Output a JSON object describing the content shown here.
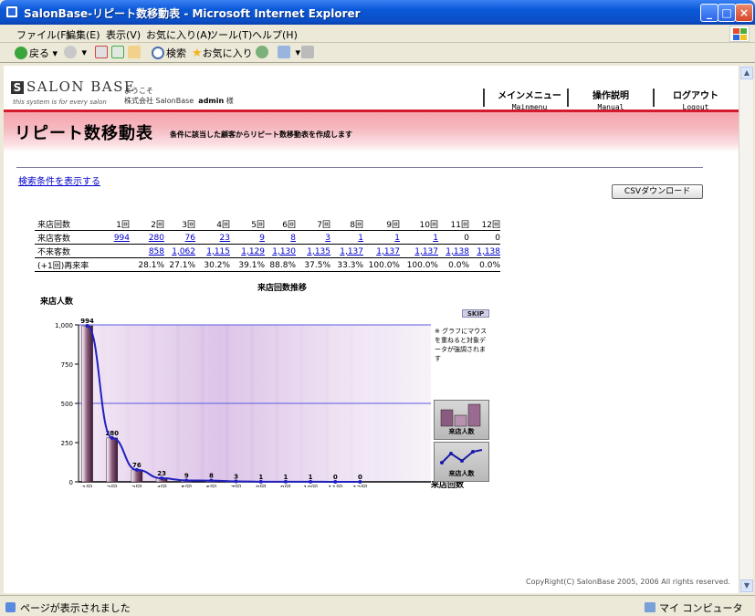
{
  "window": {
    "title": "SalonBase-リピート数移動表 - Microsoft Internet Explorer"
  },
  "menu": [
    "ファイル(F)",
    "編集(E)",
    "表示(V)",
    "お気に入り(A)",
    "ツール(T)",
    "ヘルプ(H)"
  ],
  "toolbar": {
    "back": "戻る",
    "search": "検索",
    "favorites": "お気に入り"
  },
  "site": {
    "logo": "SALON BASE",
    "logo_sub": "this system is for every salon",
    "welcome": "ようこそ",
    "company": "株式会社 SalonBase",
    "user": "admin",
    "honorific": "様",
    "nav": [
      {
        "jp": "メインメニュー",
        "en": "Mainmenu"
      },
      {
        "jp": "操作説明",
        "en": "Manual"
      },
      {
        "jp": "ログアウト",
        "en": "Logout"
      }
    ]
  },
  "page": {
    "title": "リピート数移動表",
    "description": "条件に該当した顧客からリピート数移動表を作成します",
    "search_link": "検索条件を表示する",
    "csv_button": "CSVダウンロード"
  },
  "table": {
    "row_labels": [
      "来店回数",
      "来店客数",
      "不来客数",
      "(+1回)再来率"
    ],
    "visits": [
      "1回",
      "2回",
      "3回",
      "4回",
      "5回",
      "6回",
      "7回",
      "8回",
      "9回",
      "10回",
      "11回",
      "12回"
    ],
    "customers": [
      "994",
      "280",
      "76",
      "23",
      "9",
      "8",
      "3",
      "1",
      "1",
      "1",
      "0",
      "0"
    ],
    "customers_linked": [
      true,
      true,
      true,
      true,
      true,
      true,
      true,
      true,
      true,
      true,
      false,
      false
    ],
    "lost": [
      "",
      "858",
      "1,062",
      "1,115",
      "1,129",
      "1,130",
      "1,135",
      "1,137",
      "1,137",
      "1,137",
      "1,138",
      "1,138"
    ],
    "rate": [
      "",
      "28.1%",
      "27.1%",
      "30.2%",
      "39.1%",
      "88.8%",
      "37.5%",
      "33.3%",
      "100.0%",
      "100.0%",
      "0.0%",
      "0.0%"
    ]
  },
  "chart_data": {
    "type": "bar",
    "title": "来店回数推移",
    "ylabel": "来店人数",
    "xlabel": "来店回数",
    "categories": [
      "1回",
      "2回",
      "3回",
      "4回",
      "5回",
      "6回",
      "7回",
      "8回",
      "9回",
      "10回",
      "11回",
      "12回"
    ],
    "values": [
      994,
      280,
      76,
      23,
      9,
      8,
      3,
      1,
      1,
      1,
      0,
      0
    ],
    "yticks": [
      "0",
      "250",
      "500",
      "750",
      "1,000"
    ],
    "ylim": [
      0,
      1000
    ],
    "line_overlay": true,
    "colors": {
      "bar": "#7a4a6a",
      "line": "#2020c0"
    }
  },
  "chart_side": {
    "skip": "SKIP",
    "note": "※ グラフにマウスを重ねると対象データが強調されます",
    "bar_button": "来店人数",
    "line_button": "来店人数"
  },
  "copyright": "CopyRight(C) SalonBase 2005, 2006 All rights reserved.",
  "status": {
    "text": "ページが表示されました",
    "zone": "マイ コンピュータ"
  }
}
